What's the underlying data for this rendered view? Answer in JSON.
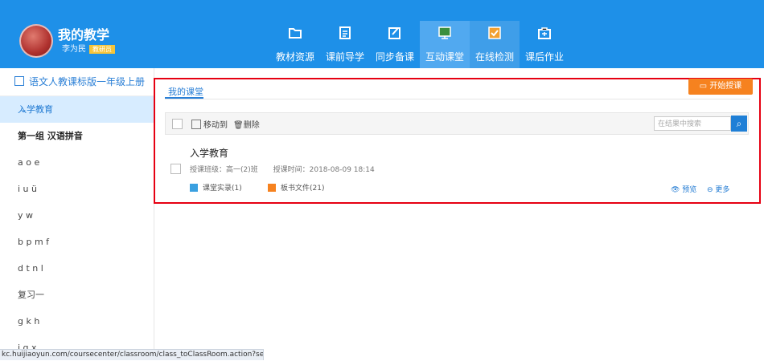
{
  "profile": {
    "name": "我的教学",
    "user": "李为民",
    "badge": "教研员"
  },
  "nav": [
    {
      "label": "教材资源",
      "icon": "folder-icon"
    },
    {
      "label": "课前导学",
      "icon": "document-icon"
    },
    {
      "label": "同步备课",
      "icon": "edit-icon"
    },
    {
      "label": "互动课堂",
      "icon": "monitor-icon"
    },
    {
      "label": "在线检测",
      "icon": "checkbox-icon"
    },
    {
      "label": "课后作业",
      "icon": "briefcase-icon"
    }
  ],
  "sidebar": {
    "book": "语文人教课标版一年级上册",
    "items": [
      "入学教育",
      "第一组 汉语拼音",
      "a o e",
      "i u ü",
      "y w",
      "b p m f",
      "d t n l",
      "复习一",
      "g k h",
      "j q x"
    ]
  },
  "main": {
    "tab": "我的课堂",
    "start_button": "开始授课",
    "toolbar": {
      "move": "移动到",
      "delete": "删除",
      "search_placeholder": "在结果中搜索"
    },
    "item": {
      "title": "入学教育",
      "class_label": "授课班级：高一(2)班",
      "time_label": "授课时间：2018-08-09 18:14",
      "record": "课堂实录(1)",
      "board": "板书文件(21)",
      "preview": "预览",
      "more": "更多"
    }
  },
  "status_url": "kc.huijiaoyun.com/coursecenter/classroom/class_toClassRoom.action?select...",
  "colors": {
    "header": "#1e90e8",
    "accent": "#1f79d2",
    "orange": "#f6821f",
    "highlight_border": "#e60012"
  }
}
